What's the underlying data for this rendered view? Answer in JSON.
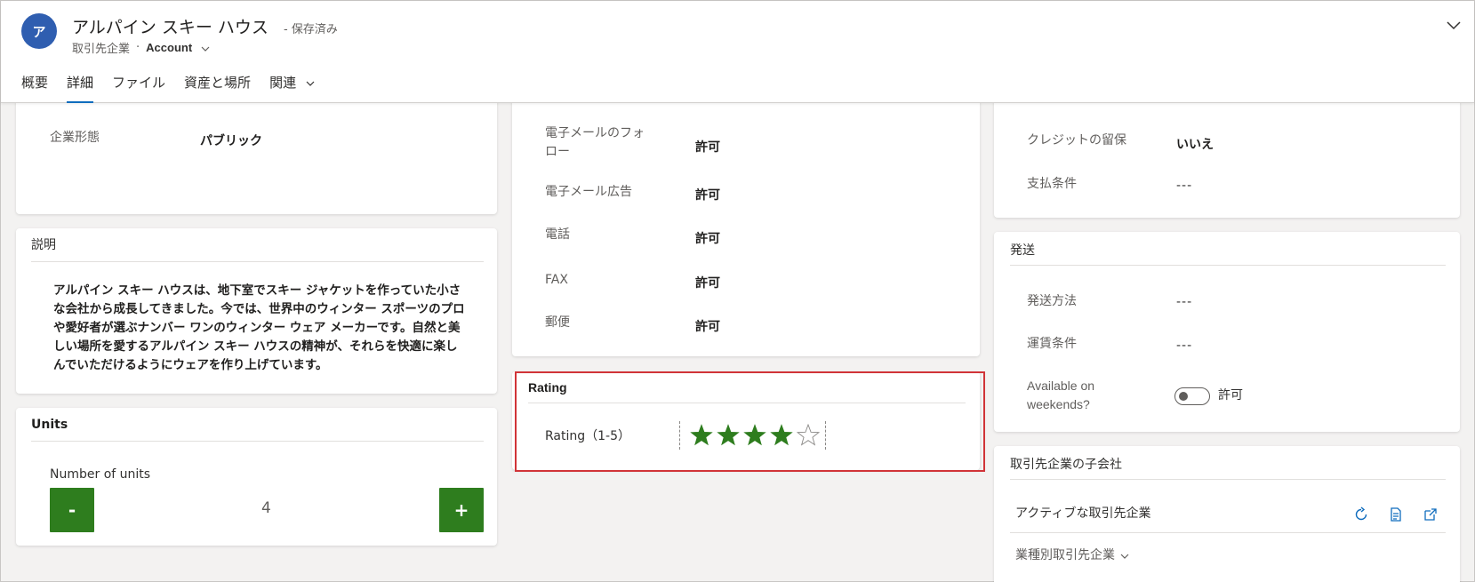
{
  "header": {
    "avatar_initial": "ア",
    "title": "アルパイン スキー ハウス",
    "saved_status": "- 保存済み",
    "entity": "取引先企業",
    "separator": "·",
    "form_name": "Account"
  },
  "tabs": [
    {
      "label": "概要"
    },
    {
      "label": "詳細"
    },
    {
      "label": "ファイル"
    },
    {
      "label": "資産と場所"
    },
    {
      "label": "関連"
    }
  ],
  "company": {
    "fields": [
      {
        "label": "企業形態",
        "value": "パブリック"
      }
    ]
  },
  "description": {
    "title": "説明",
    "text": "アルパイン スキー ハウスは、地下室でスキー ジャケットを作っていた小さな会社から成長してきました。今では、世界中のウィンター スポーツのプロや愛好者が選ぶナンバー ワンのウィンター ウェア メーカーです。自然と美しい場所を愛するアルパイン スキー ハウスの精神が、それらを快適に楽しんでいただけるようにウェアを作り上げています。"
  },
  "units": {
    "title": "Units",
    "field_label": "Number of units",
    "minus_label": "-",
    "plus_label": "+",
    "value": "4"
  },
  "contact_prefs": {
    "fields": [
      {
        "label": "電子メールのフォロー",
        "value": "許可"
      },
      {
        "label": "電子メール広告",
        "value": "許可"
      },
      {
        "label": "電話",
        "value": "許可"
      },
      {
        "label": "FAX",
        "value": "許可"
      },
      {
        "label": "郵便",
        "value": "許可"
      }
    ]
  },
  "rating": {
    "title": "Rating",
    "field_label": "Rating（1-5）",
    "value": 4,
    "max": 5,
    "star_color": "#2e7d1e"
  },
  "billing": {
    "fields": [
      {
        "label": "クレジットの留保",
        "value": "いいえ"
      },
      {
        "label": "支払条件",
        "value": "---"
      }
    ]
  },
  "shipping": {
    "title": "発送",
    "fields": [
      {
        "label": "発送方法",
        "value": "---"
      },
      {
        "label": "運賃条件",
        "value": "---"
      }
    ],
    "toggle_label": "Available on weekends?",
    "toggle_value": "許可"
  },
  "subgrid": {
    "title": "取引先企業の子会社",
    "view_name": "アクティブな取引先企業",
    "related_view": "業種別取引先企業",
    "icons": [
      "refresh-icon",
      "report-icon",
      "open-icon"
    ]
  },
  "colors": {
    "accent": "#0f6cbd",
    "avatar": "#2f5eb0",
    "stepper": "#2e7d1e",
    "highlight": "#d13438"
  }
}
